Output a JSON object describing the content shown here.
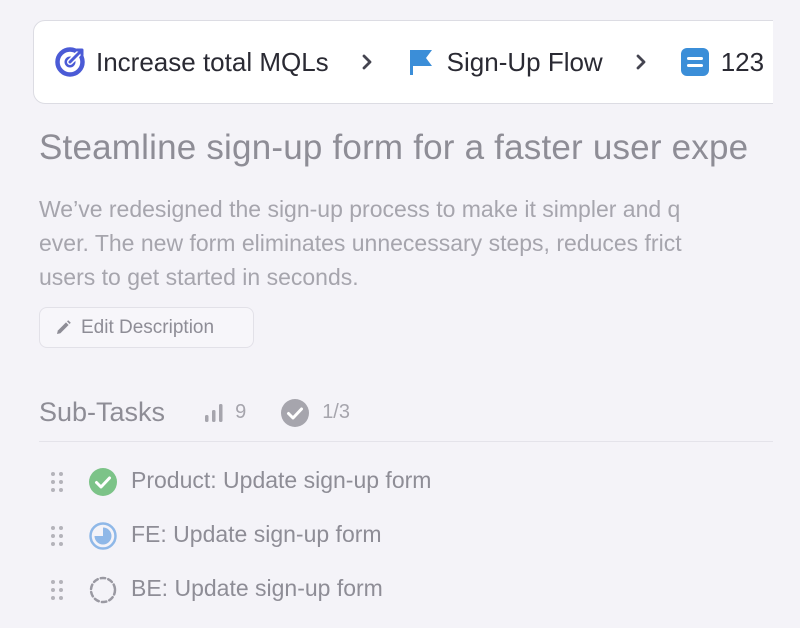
{
  "breadcrumb": {
    "items": [
      {
        "label": "Increase total MQLs",
        "icon": "goal-target-icon",
        "color": "#4b5bd6"
      },
      {
        "label": "Sign-Up Flow",
        "icon": "flag-icon",
        "color": "#3b8ed8"
      },
      {
        "label": "123",
        "icon": "document-icon",
        "color": "#3b8ed8"
      }
    ]
  },
  "task": {
    "title": "Steamline sign-up form for a faster user expe",
    "description_lines": [
      "We’ve redesigned the sign-up process to make it simpler and q",
      "ever. The new form eliminates unnecessary steps, reduces frict",
      "users to get started in seconds."
    ],
    "edit_label": "Edit Description"
  },
  "subtasks": {
    "title": "Sub-Tasks",
    "points": "9",
    "progress": "1/3",
    "items": [
      {
        "label": "Product: Update sign-up form",
        "status": "done"
      },
      {
        "label": "FE: Update sign-up form",
        "status": "in-progress"
      },
      {
        "label": "BE: Update sign-up form",
        "status": "todo"
      }
    ]
  },
  "colors": {
    "background": "#f4f3f8",
    "done": "#7cc388",
    "in_progress": "#8fb8e8",
    "muted_text": "#8e8d96"
  }
}
